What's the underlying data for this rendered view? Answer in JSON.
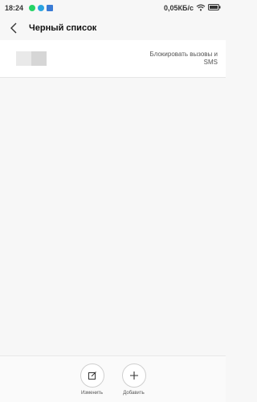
{
  "status_bar": {
    "time": "18:24",
    "network_speed": "0,05КБ/с",
    "notification_icons": [
      {
        "name": "whatsapp-icon",
        "color": "#25d366"
      },
      {
        "name": "telegram-icon",
        "color": "#2aa3e0"
      },
      {
        "name": "app-notification-icon",
        "color": "#3a7bd5"
      }
    ],
    "status_icons": [
      "wifi-icon",
      "battery-icon"
    ]
  },
  "header": {
    "title": "Черный список",
    "back_icon": "chevron-left-icon"
  },
  "list": {
    "rows": [
      {
        "action_label": "Блокировать вызовы и SMS"
      }
    ]
  },
  "bottom_bar": {
    "edit_label": "Изменить",
    "add_label": "Добавить",
    "edit_icon": "edit-icon",
    "add_icon": "plus-icon"
  },
  "colors": {
    "background": "#f7f7f7",
    "list_background": "#ffffff",
    "divider": "#e6e6e6"
  }
}
